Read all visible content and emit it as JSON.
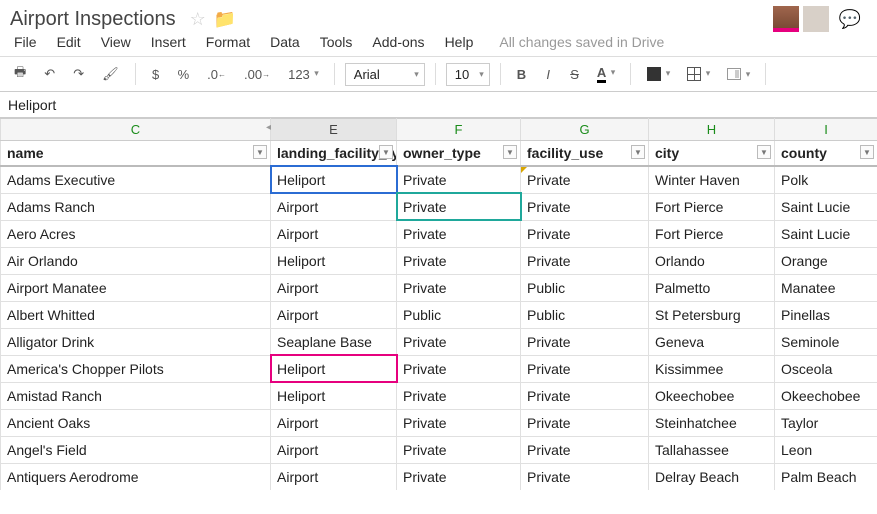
{
  "doc_title": "Airport Inspections",
  "save_status": "All changes saved in Drive",
  "menus": {
    "file": "File",
    "edit": "Edit",
    "view": "View",
    "insert": "Insert",
    "format": "Format",
    "data": "Data",
    "tools": "Tools",
    "addons": "Add-ons",
    "help": "Help"
  },
  "toolbar": {
    "currency": "$",
    "percent": "%",
    "dec_dec": ".0←",
    "inc_dec": ".00→",
    "numfmt": "123",
    "font": "Arial",
    "size": "10",
    "bold": "B",
    "italic": "I",
    "strike": "S",
    "textcolor": "A"
  },
  "formula_bar": {
    "value": "Heliport"
  },
  "columns": {
    "C": "C",
    "E": "E",
    "F": "F",
    "G": "G",
    "H": "H",
    "I": "I"
  },
  "headers": {
    "name": "name",
    "landing": "landing_facility_type",
    "owner": "owner_type",
    "facility": "facility_use",
    "city": "city",
    "county": "county"
  },
  "rows": [
    {
      "name": "Adams Executive",
      "landing": "Heliport",
      "owner": "Private",
      "facility": "Private",
      "city": "Winter Haven",
      "county": "Polk"
    },
    {
      "name": "Adams Ranch",
      "landing": "Airport",
      "owner": "Private",
      "facility": "Private",
      "city": "Fort Pierce",
      "county": "Saint Lucie"
    },
    {
      "name": "Aero Acres",
      "landing": "Airport",
      "owner": "Private",
      "facility": "Private",
      "city": "Fort Pierce",
      "county": "Saint Lucie"
    },
    {
      "name": "Air Orlando",
      "landing": "Heliport",
      "owner": "Private",
      "facility": "Private",
      "city": "Orlando",
      "county": "Orange"
    },
    {
      "name": "Airport Manatee",
      "landing": "Airport",
      "owner": "Private",
      "facility": "Public",
      "city": "Palmetto",
      "county": "Manatee"
    },
    {
      "name": "Albert Whitted",
      "landing": "Airport",
      "owner": "Public",
      "facility": "Public",
      "city": "St Petersburg",
      "county": "Pinellas"
    },
    {
      "name": "Alligator Drink",
      "landing": "Seaplane Base",
      "owner": "Private",
      "facility": "Private",
      "city": "Geneva",
      "county": "Seminole"
    },
    {
      "name": "America's Chopper Pilots",
      "landing": "Heliport",
      "owner": "Private",
      "facility": "Private",
      "city": "Kissimmee",
      "county": "Osceola"
    },
    {
      "name": "Amistad Ranch",
      "landing": "Heliport",
      "owner": "Private",
      "facility": "Private",
      "city": "Okeechobee",
      "county": "Okeechobee"
    },
    {
      "name": "Ancient Oaks",
      "landing": "Airport",
      "owner": "Private",
      "facility": "Private",
      "city": "Steinhatchee",
      "county": "Taylor"
    },
    {
      "name": "Angel's Field",
      "landing": "Airport",
      "owner": "Private",
      "facility": "Private",
      "city": "Tallahassee",
      "county": "Leon"
    },
    {
      "name": "Antiquers Aerodrome",
      "landing": "Airport",
      "owner": "Private",
      "facility": "Private",
      "city": "Delray Beach",
      "county": "Palm Beach"
    }
  ]
}
